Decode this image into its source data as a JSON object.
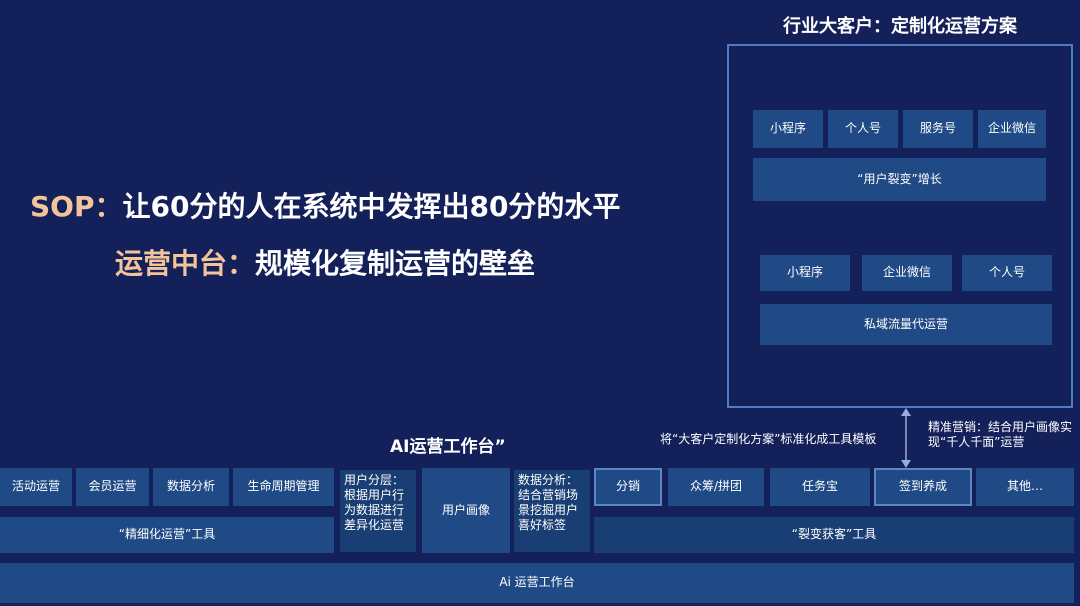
{
  "headline": {
    "sop_prefix": "SOP：",
    "sop_rest": "让60分的人在系统中发挥出80分的水平",
    "middle_prefix": "运营中台：",
    "middle_rest": "规模化复制运营的壁垒"
  },
  "custom_panel": {
    "title": "行业大客户：定制化运营方案",
    "group1": {
      "items": [
        "小程序",
        "个人号",
        "服务号",
        "企业微信"
      ],
      "footer": "“用户裂变”增长"
    },
    "group2": {
      "items": [
        "小程序",
        "企业微信",
        "个人号"
      ],
      "footer": "私域流量代运营"
    }
  },
  "annotations": {
    "template_note": "将“大客户定制化方案”标准化成工具模板",
    "precision_note": "精准营销：结合用户画像实现“千人千面”运营"
  },
  "platform": {
    "title": "AI运营工作台”",
    "left_tools": [
      "活动运营",
      "会员运营",
      "数据分析",
      "生命周期管理"
    ],
    "left_footer": "“精细化运营”工具",
    "user_layering": "用户分层：根据用户行为数据进行差异化运营",
    "user_profile": "用户画像",
    "data_analysis": "数据分析：结合营销场景挖掘用户喜好标签",
    "right_tools": [
      "分销",
      "众筹/拼团",
      "任务宝",
      "签到养成",
      "其他…"
    ],
    "right_footer": "“裂变获客”工具",
    "base": "Ai 运营工作台"
  }
}
